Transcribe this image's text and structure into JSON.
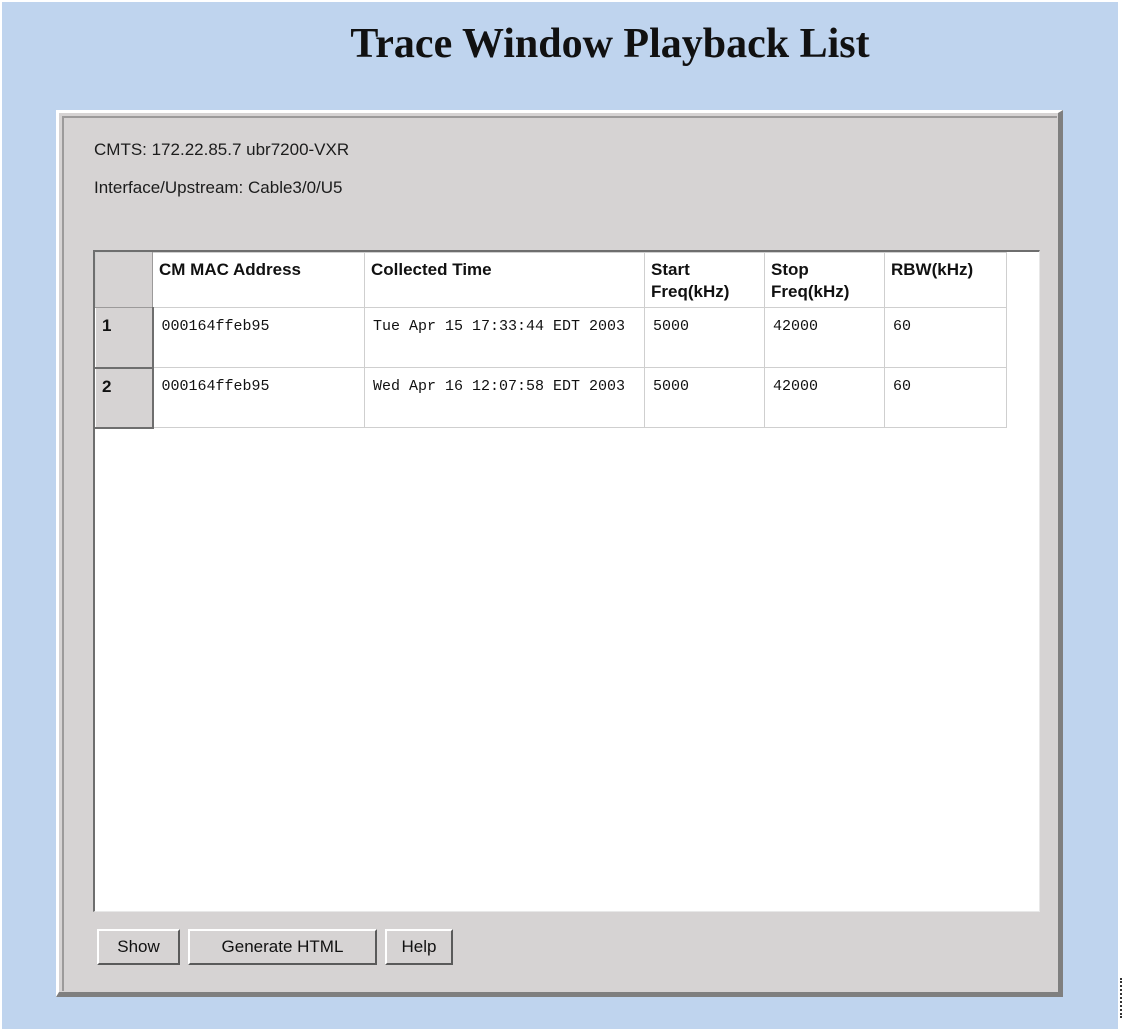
{
  "page": {
    "title": "Trace Window Playback List",
    "background_color": "#bfd4ee"
  },
  "info": {
    "cmts": "CMTS: 172.22.85.7 ubr7200-VXR",
    "interface": "Interface/Upstream: Cable3/0/U5"
  },
  "table": {
    "columns": [
      "CM MAC Address",
      "Collected Time",
      "Start Freq(kHz)",
      "Stop Freq(kHz)",
      "RBW(kHz)"
    ],
    "rows": [
      {
        "num": "1",
        "mac": "000164ffeb95",
        "time": "Tue Apr 15 17:33:44 EDT 2003",
        "start": "5000",
        "stop": "42000",
        "rbw": "60"
      },
      {
        "num": "2",
        "mac": "000164ffeb95",
        "time": "Wed Apr 16 12:07:58 EDT 2003",
        "start": "5000",
        "stop": "42000",
        "rbw": "60"
      }
    ]
  },
  "buttons": {
    "show": "Show",
    "generate_html": "Generate HTML",
    "help": "Help"
  }
}
